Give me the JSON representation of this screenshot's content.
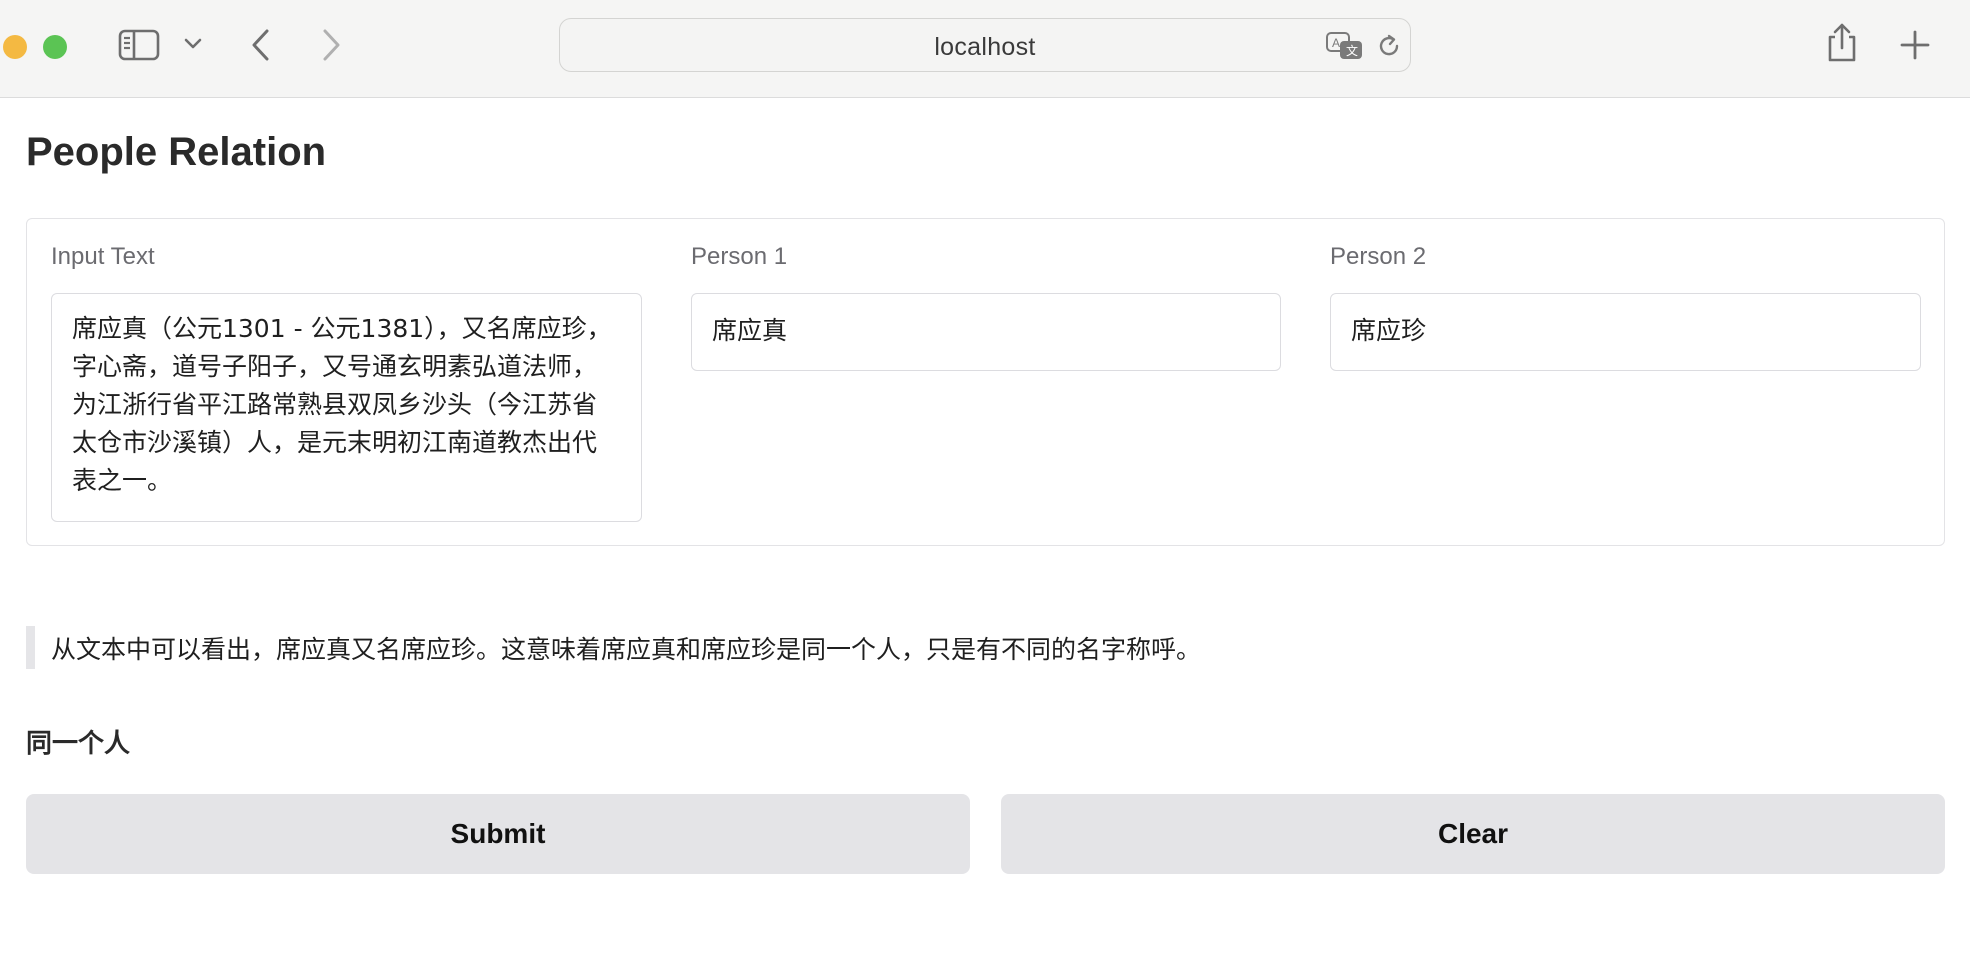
{
  "browser": {
    "url": "localhost"
  },
  "page": {
    "title": "People Relation"
  },
  "form": {
    "input_text": {
      "label": "Input Text",
      "value": "席应真（公元1301 - 公元1381），又名席应珍，字心斋，道号子阳子，又号通玄明素弘道法师，为江浙行省平江路常熟县双凤乡沙头（今江苏省太仓市沙溪镇）人，是元末明初江南道教杰出代表之一。"
    },
    "person1": {
      "label": "Person 1",
      "value": "席应真"
    },
    "person2": {
      "label": "Person 2",
      "value": "席应珍"
    }
  },
  "output": {
    "explanation": "从文本中可以看出，席应真又名席应珍。这意味着席应真和席应珍是同一个人，只是有不同的名字称呼。",
    "label": "同一个人"
  },
  "buttons": {
    "submit": "Submit",
    "clear": "Clear"
  },
  "icons": {
    "sidebar": "sidebar-icon",
    "back": "chevron-left-icon",
    "forward": "chevron-right-icon",
    "translate": "translate-icon",
    "reload": "reload-icon",
    "share": "share-icon",
    "new_tab": "plus-icon"
  }
}
